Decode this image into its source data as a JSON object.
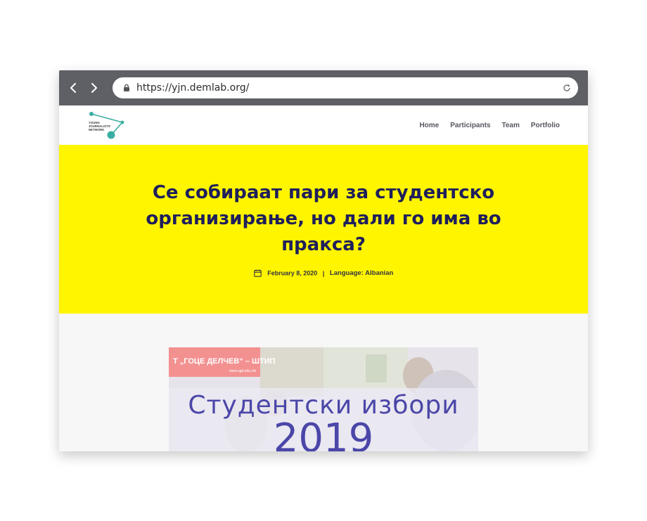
{
  "browser": {
    "url": "https://yjn.demlab.org/",
    "back_icon": "chevron-left-icon",
    "forward_icon": "chevron-right-icon",
    "lock_icon": "lock-icon",
    "reload_icon": "reload-icon"
  },
  "site": {
    "logo_text": [
      "YOUNG",
      "JOURNALISTS'",
      "NETWORK"
    ],
    "logo_color": "#3aaea0",
    "nav": [
      "Home",
      "Participants",
      "Team",
      "Portfolio"
    ]
  },
  "hero": {
    "title": "Се собираат пари за студентско организирање, но дали го има во пракса?",
    "date": "February 8, 2020",
    "separator": "|",
    "language": "Language: Albanian",
    "background": "#fff500",
    "title_color": "#1f1f5c"
  },
  "featured_image": {
    "banner": "Т „ГОЦЕ ДЕЛЧЕВ“ – ШТИП",
    "banner_sub": "www.ugd.edu.mk",
    "line1": "Студентски  избори",
    "line2": "2019"
  }
}
